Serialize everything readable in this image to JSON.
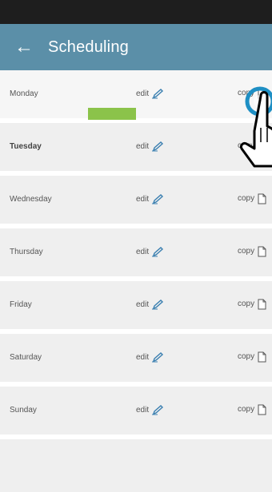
{
  "header": {
    "title": "Scheduling",
    "back_icon": "arrow-left-icon"
  },
  "schedule": {
    "edit_label": "edit",
    "copy_label": "copy",
    "days": [
      {
        "label": "Monday"
      },
      {
        "label": "Tuesday"
      },
      {
        "label": "Wednesday"
      },
      {
        "label": "Thursday"
      },
      {
        "label": "Friday"
      },
      {
        "label": "Saturday"
      },
      {
        "label": "Sunday"
      }
    ]
  },
  "colors": {
    "appbar": "#5b8fa8",
    "statusbar": "#1e1e1e",
    "accent_green": "#8bc34a",
    "tap_indicator": "#1e8fc4"
  },
  "icons": {
    "edit": "pencil-icon",
    "copy": "copy-icon",
    "gesture": "hand-pointer-icon"
  }
}
